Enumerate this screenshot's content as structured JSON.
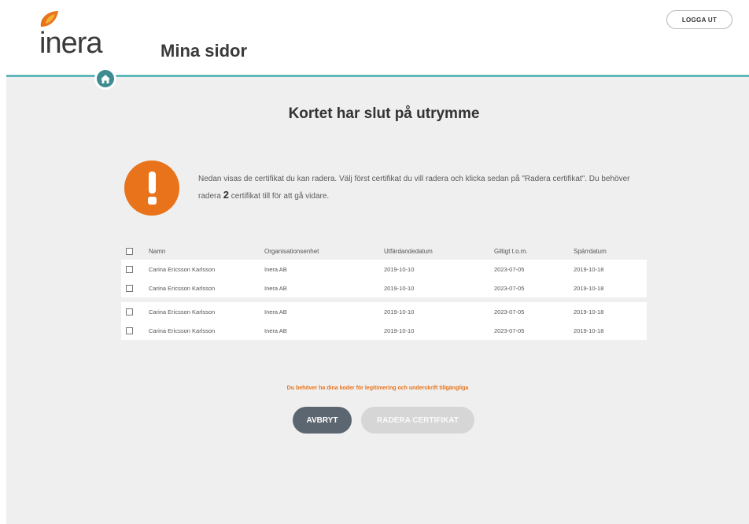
{
  "header": {
    "logo_text": "inera",
    "site_title": "Mina sidor",
    "logout_label": "LOGGA UT"
  },
  "main": {
    "heading": "Kortet har slut på utrymme",
    "info_part1": "Nedan visas de certifikat du kan radera. Välj först certifikat du vill radera och klicka sedan på \"Radera certifikat\". Du behöver radera ",
    "info_count": "2",
    "info_part2": " certifikat till för att gå vidare.",
    "table": {
      "columns": [
        "Namn",
        "Organisationsenhet",
        "Utfärdandedatum",
        "Giltigt t.o.m.",
        "Spärrdatum"
      ],
      "groups": [
        [
          [
            "Carina Ericsson Karlsson",
            "Inera AB",
            "2019-10-10",
            "2023-07-05",
            "2019-10-18"
          ],
          [
            "Carina Ericsson Karlsson",
            "Inera AB",
            "2019-10-10",
            "2023-07-05",
            "2019-10-18"
          ]
        ],
        [
          [
            "Carina Ericsson Karlsson",
            "Inera AB",
            "2019-10-10",
            "2023-07-05",
            "2019-10-18"
          ],
          [
            "Carina Ericsson Karlsson",
            "Inera AB",
            "2019-10-10",
            "2023-07-05",
            "2019-10-18"
          ]
        ]
      ]
    },
    "notice": "Du behöver ha dina koder för legitimering och underskrift tillgängliga",
    "cancel_label": "AVBRYT",
    "delete_label": "RADERA CERTIFIKAT"
  },
  "colors": {
    "accent": "#5fb7b9",
    "warning": "#e8731a",
    "cancel_button": "#5c6670",
    "disabled_button": "#d6d6d6"
  },
  "icons": [
    "inera-logo-mark",
    "home-icon",
    "exclamation-icon",
    "checkbox"
  ]
}
